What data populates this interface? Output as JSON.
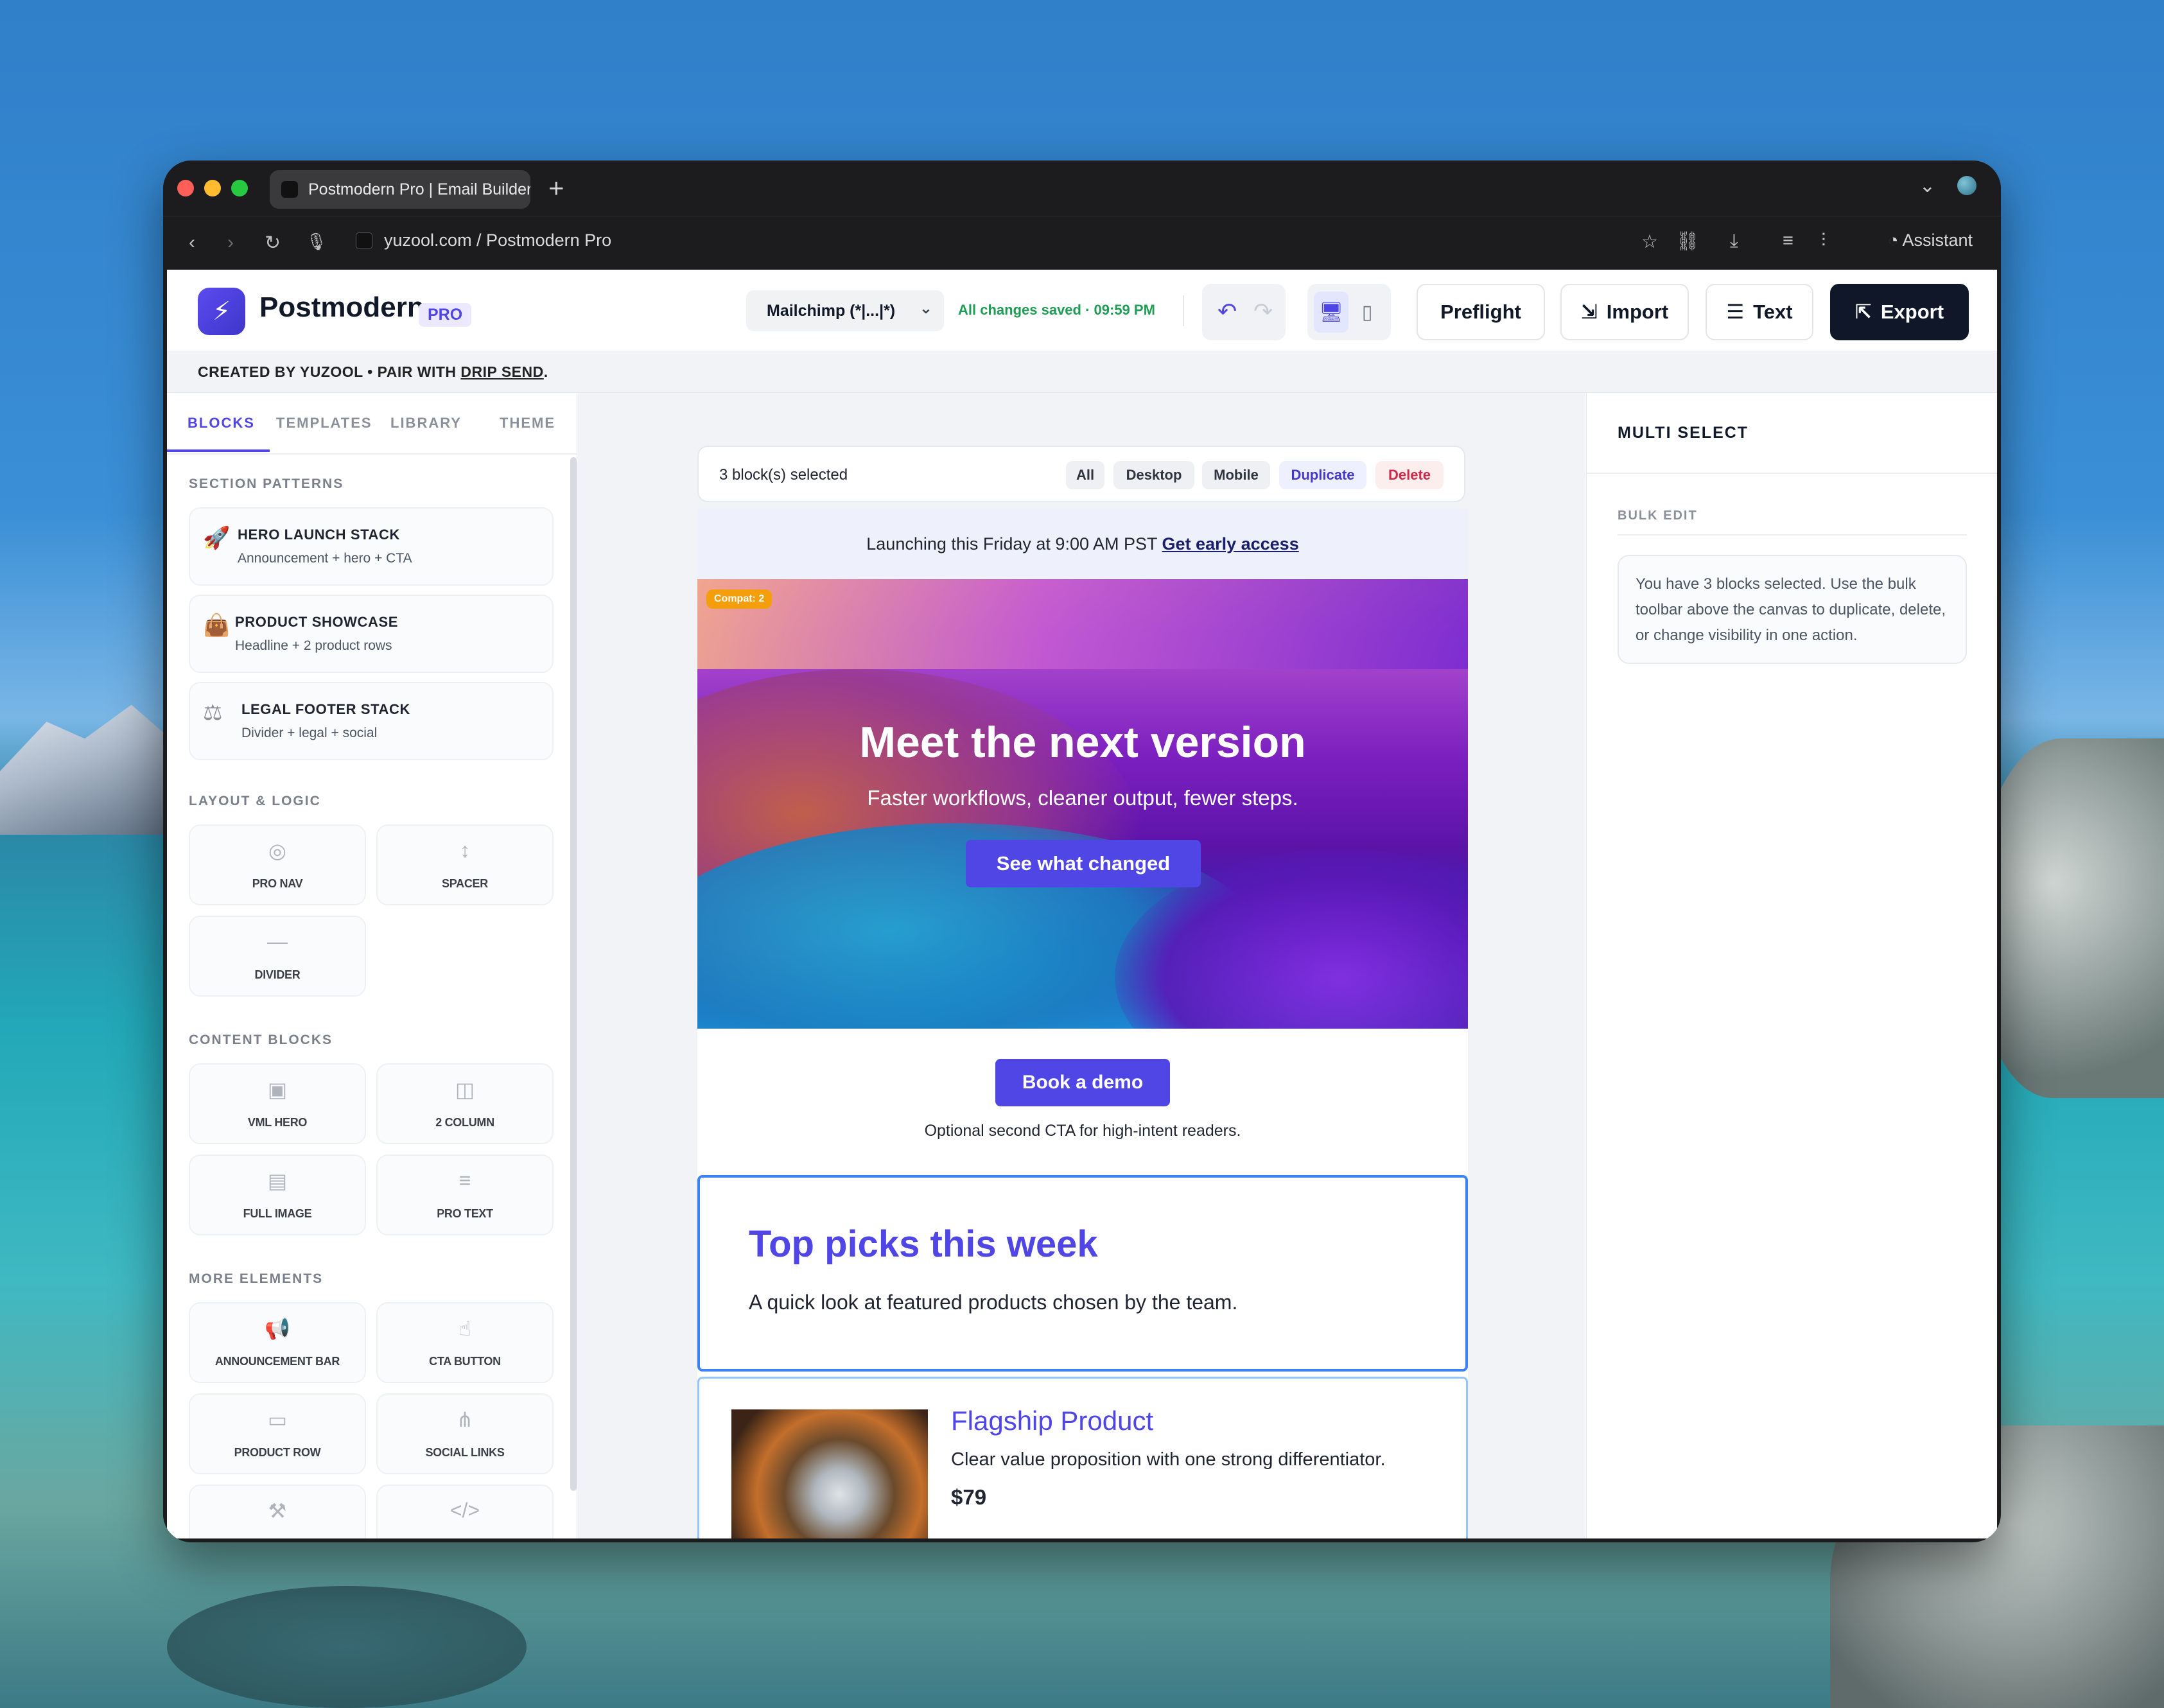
{
  "browser": {
    "tab_title": "Postmodern Pro | Email Builder",
    "new_tab": "+",
    "url": "yuzool.com / Postmodern Pro",
    "assistant": "Assistant"
  },
  "header": {
    "brand": "Postmodern",
    "badge": "PRO",
    "esp_select": "Mailchimp (*|...|*)",
    "save_status": "All changes saved · 09:59 PM",
    "preflight": "Preflight",
    "import": "Import",
    "text": "Text",
    "export": "Export"
  },
  "credit": {
    "prefix": "CREATED BY YUZOOL • PAIR WITH ",
    "link": "DRIP SEND",
    "suffix": "."
  },
  "sidebar": {
    "tabs": [
      "BLOCKS",
      "TEMPLATES",
      "LIBRARY",
      "THEME"
    ],
    "section_patterns": "SECTION PATTERNS",
    "patterns": [
      {
        "title": "HERO LAUNCH STACK",
        "subtitle": "Announcement + hero + CTA"
      },
      {
        "title": "PRODUCT SHOWCASE",
        "subtitle": "Headline + 2 product rows"
      },
      {
        "title": "LEGAL FOOTER STACK",
        "subtitle": "Divider + legal + social"
      }
    ],
    "section_layout": "LAYOUT & LOGIC",
    "layout_tiles": [
      "PRO NAV",
      "SPACER",
      "DIVIDER"
    ],
    "section_content": "CONTENT BLOCKS",
    "content_tiles": [
      "VML HERO",
      "2 COLUMN",
      "FULL IMAGE",
      "PRO TEXT"
    ],
    "section_more": "MORE ELEMENTS",
    "more_tiles": [
      "ANNOUNCEMENT BAR",
      "CTA BUTTON",
      "PRODUCT ROW",
      "SOCIAL LINKS"
    ]
  },
  "canvas": {
    "selected": "3 block(s) selected",
    "chips": [
      "All",
      "Desktop",
      "Mobile",
      "Duplicate",
      "Delete"
    ],
    "announcement": "Launching this Friday at 9:00 AM PST",
    "announcement_link": "Get early access",
    "compat": "Compat: 2",
    "hero_title": "Meet the next version",
    "hero_sub": "Faster workflows, cleaner output, fewer steps.",
    "hero_cta": "See what changed",
    "demo_cta": "Book a demo",
    "demo_note": "Optional second CTA for high-intent readers.",
    "picks_title": "Top picks this week",
    "picks_text": "A quick look at featured products chosen by the team.",
    "product_name": "Flagship Product",
    "product_desc": "Clear value proposition with one strong differentiator.",
    "product_price": "$79"
  },
  "right_panel": {
    "title": "MULTI SELECT",
    "section": "BULK EDIT",
    "info": "You have 3 blocks selected. Use the bulk toolbar above the canvas to duplicate, delete, or change visibility in one action."
  }
}
